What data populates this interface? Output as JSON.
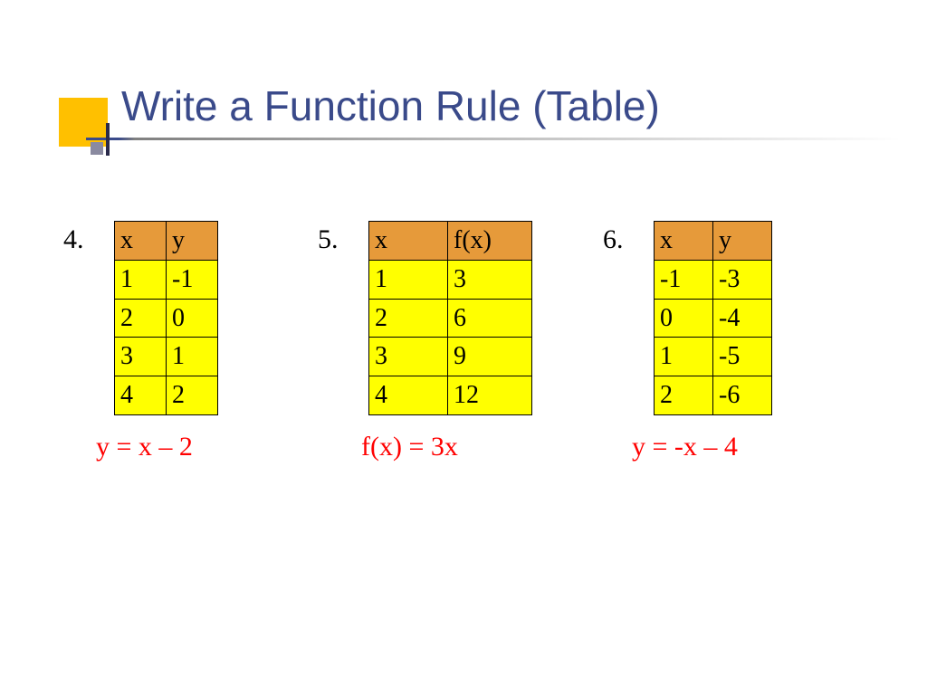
{
  "title": "Write a Function Rule (Table)",
  "problems": {
    "p4": {
      "label": "4.",
      "headers": [
        "x",
        "y"
      ],
      "rows": [
        [
          "1",
          "-1"
        ],
        [
          "2",
          "0"
        ],
        [
          "3",
          "1"
        ],
        [
          "4",
          "2"
        ]
      ],
      "answer": "y = x – 2"
    },
    "p5": {
      "label": "5.",
      "headers": [
        "x",
        "f(x)"
      ],
      "rows": [
        [
          "1",
          "3"
        ],
        [
          "2",
          "6"
        ],
        [
          "3",
          "9"
        ],
        [
          "4",
          "12"
        ]
      ],
      "answer": "f(x) = 3x"
    },
    "p6": {
      "label": "6.",
      "headers": [
        "x",
        "y"
      ],
      "rows": [
        [
          "-1",
          "-3"
        ],
        [
          "0",
          "-4"
        ],
        [
          "1",
          "-5"
        ],
        [
          "2",
          "-6"
        ]
      ],
      "answer": "y = -x – 4"
    }
  }
}
